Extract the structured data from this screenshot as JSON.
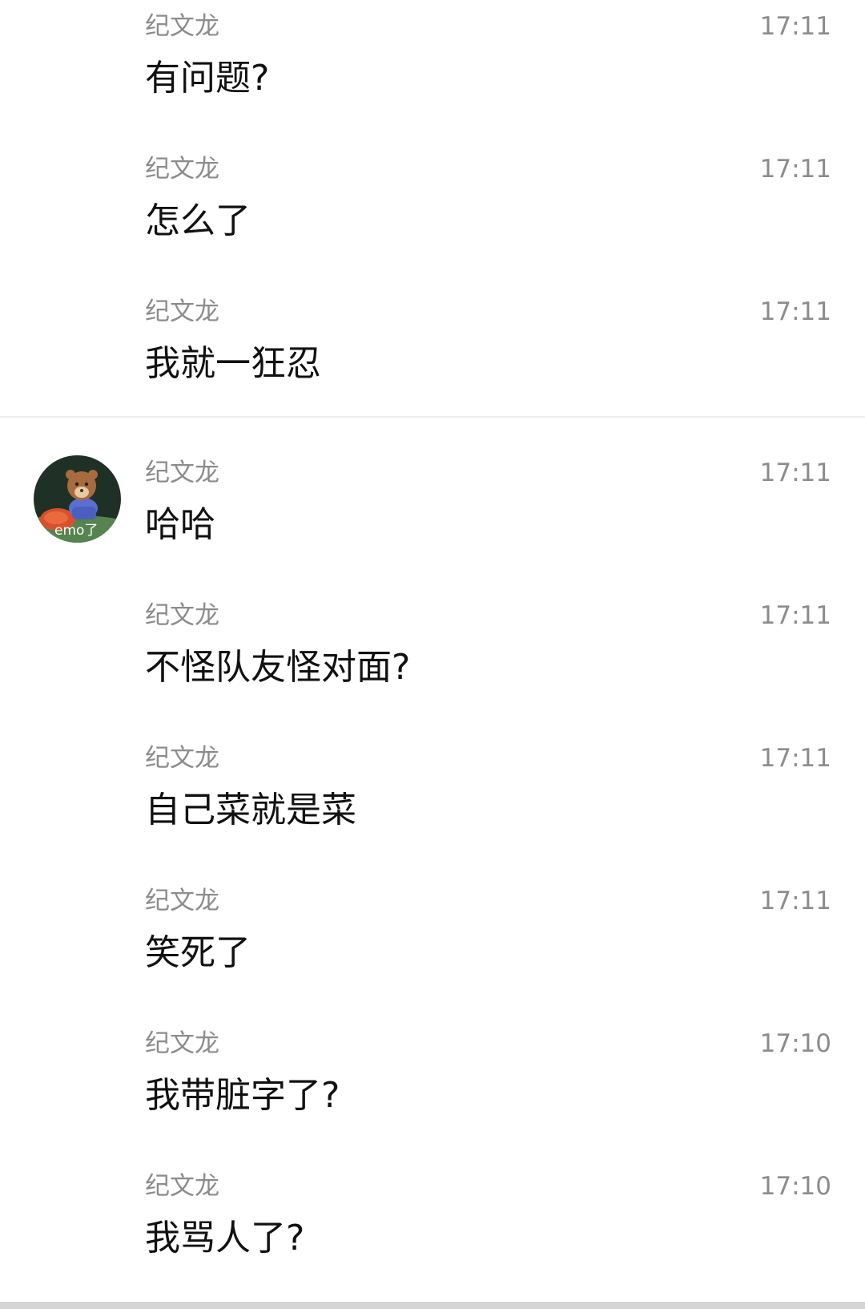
{
  "messages": [
    {
      "sender": "纪文龙",
      "time": "17:11",
      "text": "有问题?"
    },
    {
      "sender": "纪文龙",
      "time": "17:11",
      "text": "怎么了"
    },
    {
      "sender": "纪文龙",
      "time": "17:11",
      "text": "我就一狂忍"
    },
    {
      "sender": "纪文龙",
      "time": "17:11",
      "text": "哈哈"
    },
    {
      "sender": "纪文龙",
      "time": "17:11",
      "text": "不怪队友怪对面?"
    },
    {
      "sender": "纪文龙",
      "time": "17:11",
      "text": "自己菜就是菜"
    },
    {
      "sender": "纪文龙",
      "time": "17:11",
      "text": "笑死了"
    },
    {
      "sender": "纪文龙",
      "time": "17:10",
      "text": "我带脏字了?"
    },
    {
      "sender": "纪文龙",
      "time": "17:10",
      "text": "我骂人了?"
    }
  ],
  "avatar": {
    "caption": "emo了",
    "icon": "bear-avatar-icon"
  }
}
